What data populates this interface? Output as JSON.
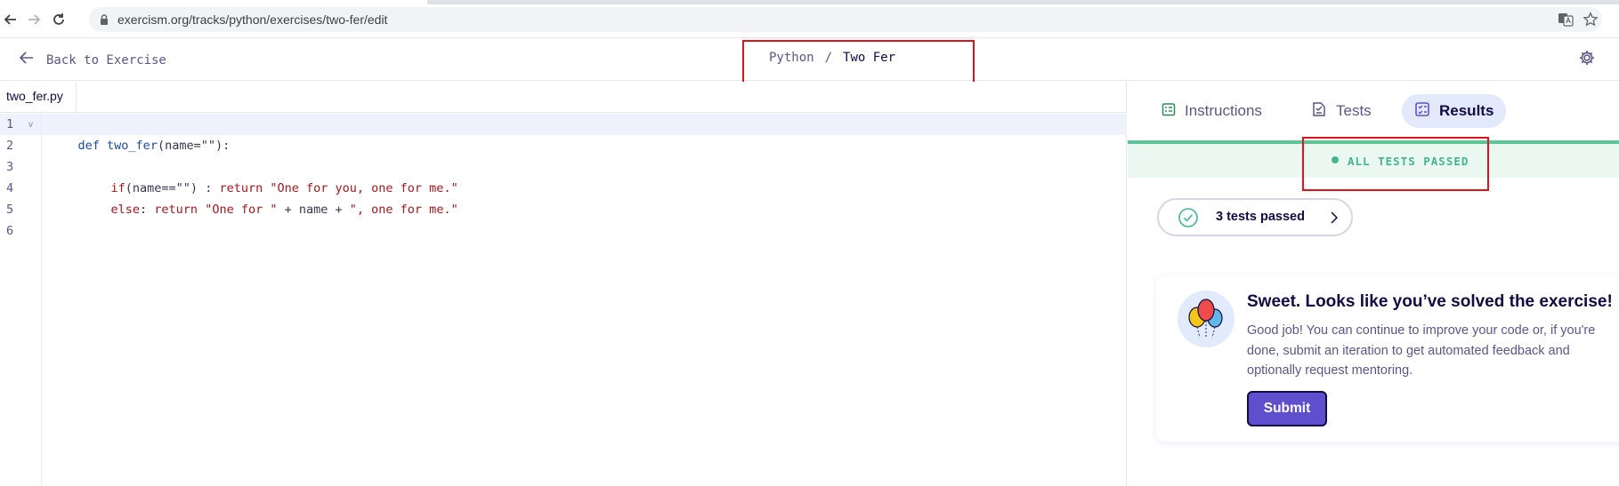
{
  "browser": {
    "url": "exercism.org/tracks/python/exercises/two-fer/edit"
  },
  "header": {
    "back_label": "Back to Exercise",
    "track": "Python",
    "separator": "/",
    "exercise": "Two Fer"
  },
  "editor": {
    "filename": "two_fer.py",
    "line_numbers": [
      "1",
      "2",
      "3",
      "4",
      "5",
      "6"
    ],
    "lines": {
      "l1_kw": "def",
      "l1_fn": "two_fer",
      "l1_rest": "(name=\"\"):",
      "l3_kw": "if",
      "l3_paren": "(name==\"\")",
      "l3_colon": " : ",
      "l3_ret": "return",
      "l3_str": "\"One for you, one for me.\"",
      "l4_kw": "else",
      "l4_colon": ": ",
      "l4_ret": "return",
      "l4_str1": "\"One for \"",
      "l4_mid": " + name + ",
      "l4_str2": "\", one for me.\""
    }
  },
  "panel": {
    "tabs": [
      {
        "label": "Instructions",
        "icon": "instructions-icon",
        "active": false
      },
      {
        "label": "Tests",
        "icon": "tests-icon",
        "active": false
      },
      {
        "label": "Results",
        "icon": "results-icon",
        "active": true
      }
    ],
    "status": "ALL TESTS PASSED",
    "tests_summary": "3 tests passed",
    "success": {
      "title": "Sweet. Looks like you’ve solved the exercise!",
      "body": "Good job! You can continue to improve your code or, if you're done, submit an iteration to get automated feedback and optionally request mentoring.",
      "submit_label": "Submit"
    }
  },
  "colors": {
    "accent": "#604fcd",
    "success": "#43b593",
    "highlight_box": "#e0131b"
  }
}
